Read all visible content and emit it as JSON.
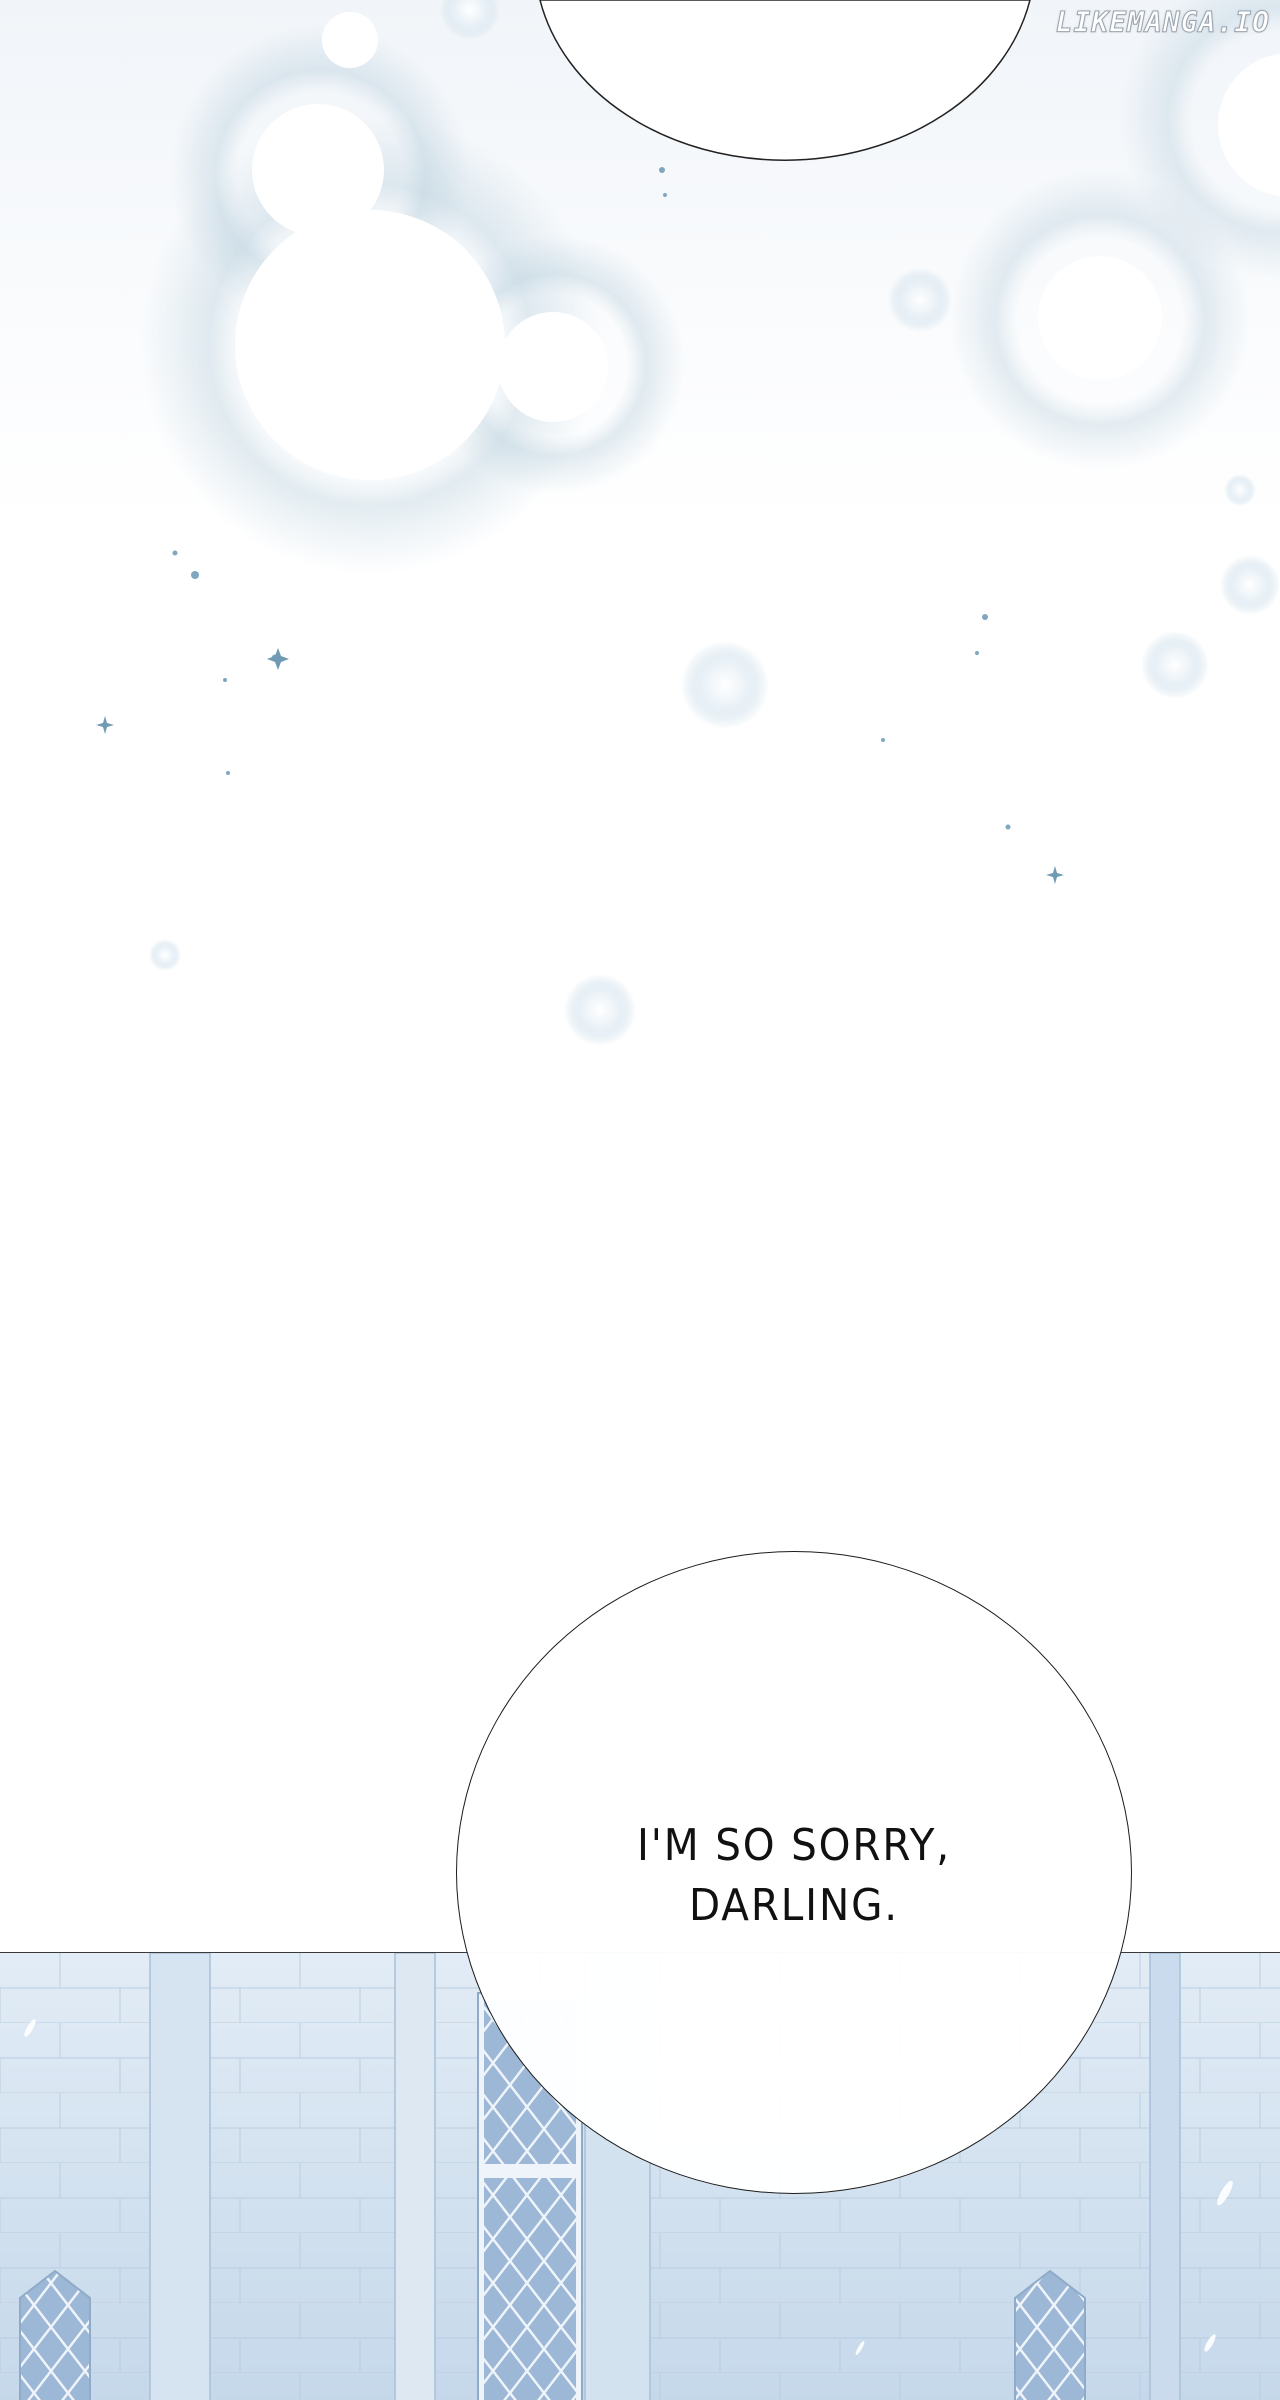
{
  "watermark": "LIKEMANGA.IO",
  "speech_bubble": {
    "line1": "I'M SO SORRY,",
    "line2": "DARLING."
  },
  "colors": {
    "sky_tint": "#eef3f8",
    "sparkle_dots": "#7fa8c0",
    "building_blue": "#c9dcef",
    "outline": "#1c1c1c"
  }
}
